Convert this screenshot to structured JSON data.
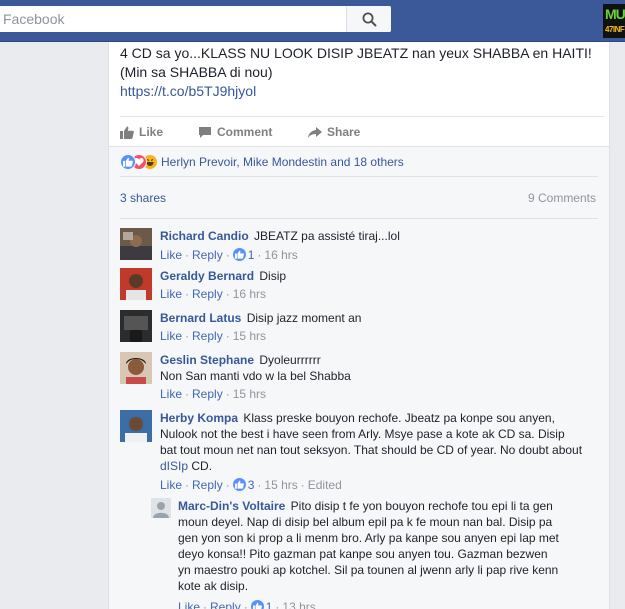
{
  "search": {
    "placeholder": "Facebook"
  },
  "corner_logo": {
    "line1": "MU",
    "line2": "47INF"
  },
  "post": {
    "text_line1": "4 CD sa yo...KLASS NU LOOK DISIP JBEATZ nan yeux SHABBA en HAITI!",
    "text_line2": "(Min sa SHABBA di nou)",
    "link": "https://t.co/b5TJ9hjyol"
  },
  "actions": {
    "like": "Like",
    "comment": "Comment",
    "share": "Share"
  },
  "reactions": {
    "names": "Herlyn Prevoir, Mike Mondestin and 18 others"
  },
  "shares": "3 shares",
  "comment_count": "9 Comments",
  "comments": [
    {
      "author": "Richard Candio",
      "text": "JBEATZ pa assisté tiraj...lol",
      "like": "Like",
      "reply": "Reply",
      "likes": "1",
      "time": "16 hrs",
      "avatar_color": "#6b5a4a"
    },
    {
      "author": "Geraldy Bernard",
      "text": "Disip",
      "like": "Like",
      "reply": "Reply",
      "time": "16 hrs",
      "avatar_color": "#c0392b"
    },
    {
      "author": "Bernard Latus",
      "text": "Disip jazz moment an",
      "like": "Like",
      "reply": "Reply",
      "time": "15 hrs",
      "avatar_color": "#2c2c2c"
    },
    {
      "author": "Geslin Stephane",
      "text": "Dyoleurrrrrr",
      "text2": "Non San manti vdo w la bel Shabba",
      "like": "Like",
      "reply": "Reply",
      "time": "15 hrs",
      "avatar_color": "#8a5a3c"
    },
    {
      "author": "Herby Kompa",
      "text": "Klass preske bouyon rechofe. Jbeatz pa konpe sou anyen,",
      "text2": "Nulook not the best i have seen from Arly. Msye pase a kote ak CD sa. Disip",
      "text3": "bat tout moun net nan tout seksyon. That should be CD of year. No doubt about",
      "text4_link": "dISIp",
      "text4_rest": "CD.",
      "like": "Like",
      "reply": "Reply",
      "likes": "3",
      "time": "15 hrs",
      "edited": "Edited",
      "avatar_color": "#3a6ea5"
    }
  ],
  "reply": {
    "author": "Marc-Din's Voltaire",
    "line1": "Pito disip t fe yon bouyon rechofe tou epi li ta gen",
    "line2": "moun deyel. Nap di disip bel album epil pa k fe moun nan bal. Disip pa",
    "line3": "gen yon son ki prop a li menm bro. Arly pa kanpe sou anyen epi lap met",
    "line4": "deyo konsa!! Pito gazman pat kanpe sou anyen tou. Gazman bezwen",
    "line5": "yn maestro pouki ap kotchel. Sil pa tounen al jwenn arly li pap rive kenn",
    "line6": "kote ak disip.",
    "like": "Like",
    "reply": "Reply",
    "likes": "1",
    "time": "13 hrs",
    "avatar_color": "#9aa3ad"
  }
}
